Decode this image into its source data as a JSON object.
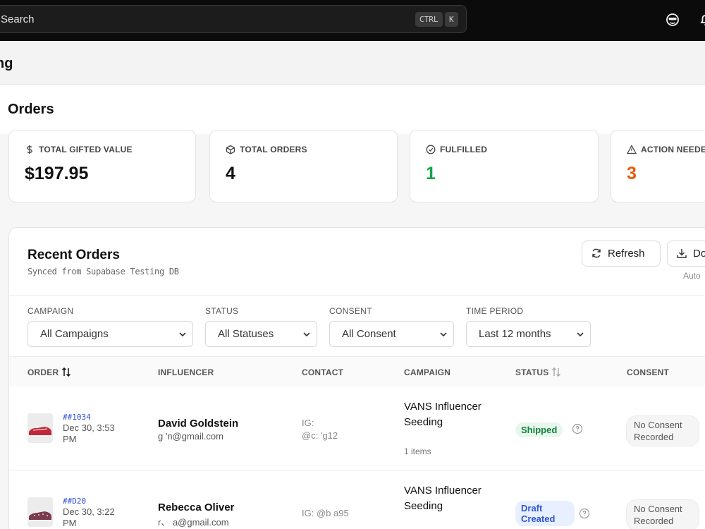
{
  "topbar": {
    "search_label": "Search",
    "shortcut_ctrl": "CTRL",
    "shortcut_k": "K"
  },
  "breadcrumb": {
    "text": "ng"
  },
  "page": {
    "title": "Orders"
  },
  "stats": [
    {
      "label": "TOTAL GIFTED VALUE",
      "value": "$197.95",
      "icon": "dollar-icon"
    },
    {
      "label": "TOTAL ORDERS",
      "value": "4",
      "icon": "package-icon"
    },
    {
      "label": "FULFILLED",
      "value": "1",
      "icon": "check-circle-icon",
      "color": "#16a34a"
    },
    {
      "label": "ACTION NEEDED",
      "value": "3",
      "icon": "warning-icon",
      "color": "#ea580c"
    }
  ],
  "orders_panel": {
    "title": "Recent Orders",
    "subtitle": "Synced from Supabase Testing DB",
    "refresh_label": "Refresh",
    "download_label": "Do",
    "auto_text": "Auto"
  },
  "filters": {
    "campaign": {
      "label": "CAMPAIGN",
      "value": "All Campaigns"
    },
    "status": {
      "label": "STATUS",
      "value": "All Statuses"
    },
    "consent": {
      "label": "CONSENT",
      "value": "All Consent"
    },
    "time_period": {
      "label": "TIME PERIOD",
      "value": "Last 12 months"
    }
  },
  "table": {
    "columns": [
      "ORDER",
      "INFLUENCER",
      "CONTACT",
      "CAMPAIGN",
      "STATUS",
      "CONSENT"
    ],
    "rows": [
      {
        "order_id": "##1034",
        "date": "Dec 30, 3:53 PM",
        "influencer_name": "David Goldstein",
        "influencer_email": "g         'n@gmail.com",
        "contact_line1": "IG:",
        "contact_line2": "@c:        'g12",
        "campaign": "VANS Influencer Seeding",
        "items": "1 items",
        "status": "Shipped",
        "consent": "No Consent Recorded"
      },
      {
        "order_id": "##D20",
        "date": "Dec 30, 3:22 PM",
        "influencer_name": "Rebecca Oliver",
        "influencer_email": "r、     a@gmail.com",
        "contact_line1": "IG: @b      a95",
        "campaign": "VANS Influencer Seeding",
        "status": "Draft Created",
        "consent": "No Consent Recorded"
      }
    ]
  },
  "colors": {
    "topbar_bg": "#0b0b0b",
    "link_blue": "#2f4fd6",
    "success_green": "#16a34a",
    "warning_orange": "#ea580c"
  }
}
